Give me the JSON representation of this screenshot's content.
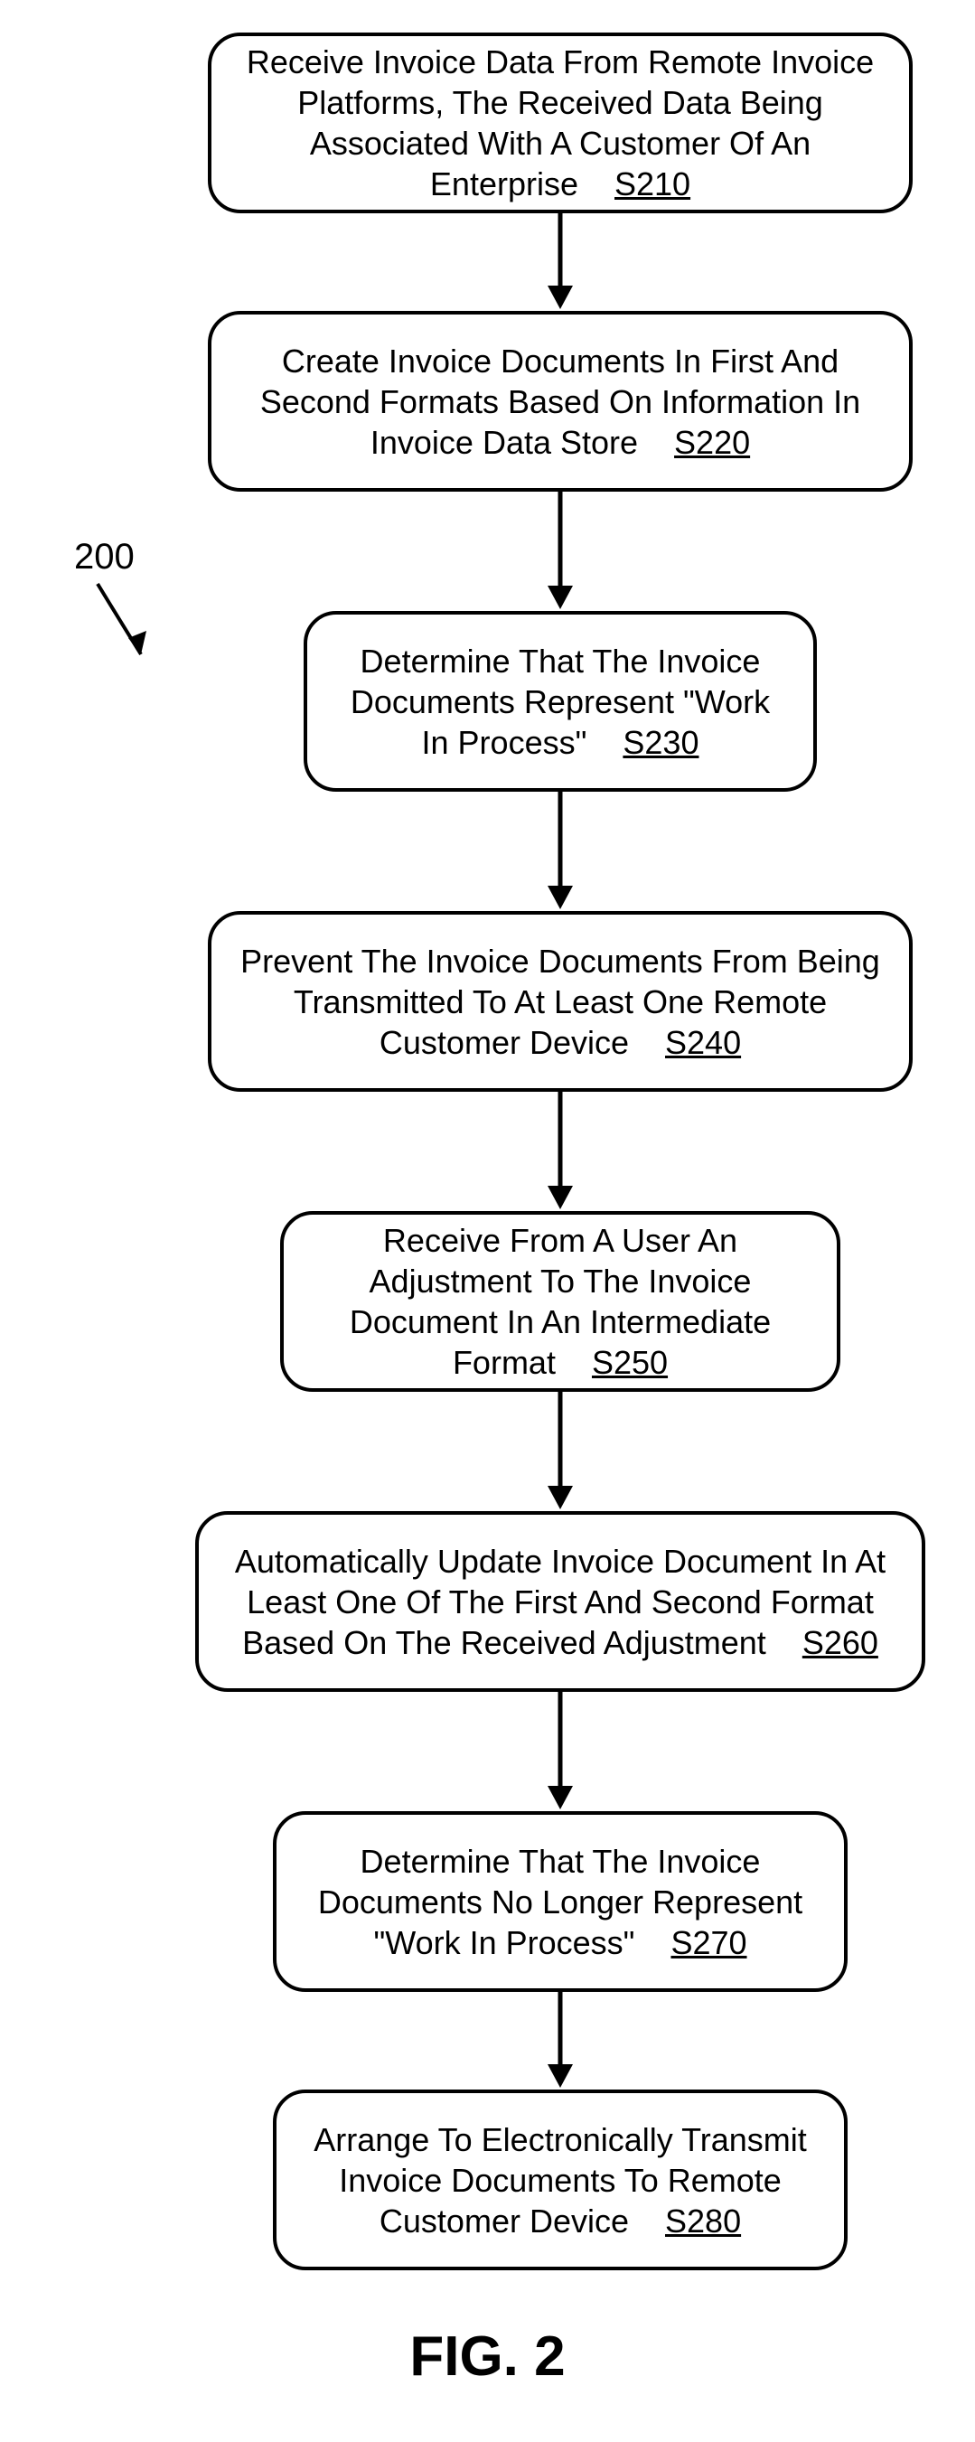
{
  "ref_number": "200",
  "figure_label": "FIG. 2",
  "steps": {
    "s210": {
      "text": "Receive Invoice Data From Remote Invoice Platforms, The Received Data Being Associated With A Customer Of An Enterprise",
      "code": "S210"
    },
    "s220": {
      "text": "Create Invoice Documents In First And Second Formats Based On Information In Invoice Data Store",
      "code": "S220"
    },
    "s230": {
      "text": "Determine That The Invoice Documents Represent \"Work In Process\"",
      "code": "S230"
    },
    "s240": {
      "text": "Prevent The Invoice Documents From Being Transmitted To At Least One Remote Customer Device",
      "code": "S240"
    },
    "s250": {
      "text": "Receive From A User An Adjustment To The Invoice Document In An Intermediate Format",
      "code": "S250"
    },
    "s260": {
      "text": "Automatically Update Invoice Document In At Least One Of The First And Second Format Based On The Received Adjustment",
      "code": "S260"
    },
    "s270": {
      "text": "Determine That The Invoice Documents No Longer Represent \"Work In Process\"",
      "code": "S270"
    },
    "s280": {
      "text": "Arrange To Electronically Transmit Invoice Documents To Remote Customer Device",
      "code": "S280"
    }
  },
  "chart_data": {
    "type": "flowchart",
    "nodes": [
      {
        "id": "S210",
        "label": "Receive Invoice Data From Remote Invoice Platforms, The Received Data Being Associated With A Customer Of An Enterprise"
      },
      {
        "id": "S220",
        "label": "Create Invoice Documents In First And Second Formats Based On Information In Invoice Data Store"
      },
      {
        "id": "S230",
        "label": "Determine That The Invoice Documents Represent \"Work In Process\""
      },
      {
        "id": "S240",
        "label": "Prevent The Invoice Documents From Being Transmitted To At Least One Remote Customer Device"
      },
      {
        "id": "S250",
        "label": "Receive From A User An Adjustment To The Invoice Document In An Intermediate Format"
      },
      {
        "id": "S260",
        "label": "Automatically Update Invoice Document In At Least One Of The First And Second Format Based On The Received Adjustment"
      },
      {
        "id": "S270",
        "label": "Determine That The Invoice Documents No Longer Represent \"Work In Process\""
      },
      {
        "id": "S280",
        "label": "Arrange To Electronically Transmit Invoice Documents To Remote Customer Device"
      }
    ],
    "edges": [
      {
        "from": "S210",
        "to": "S220"
      },
      {
        "from": "S220",
        "to": "S230"
      },
      {
        "from": "S230",
        "to": "S240"
      },
      {
        "from": "S240",
        "to": "S250"
      },
      {
        "from": "S250",
        "to": "S260"
      },
      {
        "from": "S260",
        "to": "S270"
      },
      {
        "from": "S270",
        "to": "S280"
      }
    ],
    "reference_label": "200",
    "figure": "FIG. 2"
  }
}
